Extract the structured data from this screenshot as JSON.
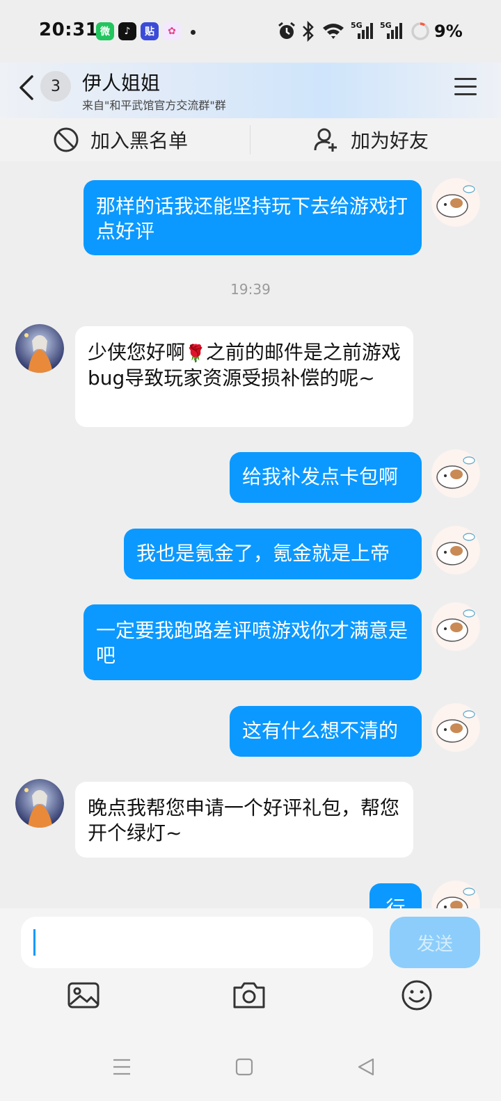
{
  "status_bar": {
    "time": "20:31",
    "apps": [
      "wechat-icon",
      "douyin-icon",
      "tieba-icon",
      "colorful-app-icon"
    ],
    "app_glyphs": [
      "微",
      "♪",
      "贴",
      "✿"
    ],
    "network": [
      "5G",
      "5G"
    ],
    "battery": "9%"
  },
  "header": {
    "unread_count": "3",
    "title": "伊人姐姐",
    "subtitle": "来自\"和平武馆官方交流群\"群"
  },
  "actions": {
    "block_label": "加入黑名单",
    "add_friend_label": "加为好友"
  },
  "messages": [
    {
      "side": "out",
      "text": "那样的话我还能坚持玩下去给游戏打点好评"
    },
    {
      "side": "time",
      "text": "19:39"
    },
    {
      "side": "in",
      "text_before": "少侠您好啊",
      "emoji": "🌹",
      "text_after": "之前的邮件是之前游戏bug导致玩家资源受损补偿的呢~"
    },
    {
      "side": "out",
      "text": "给我补发点卡包啊"
    },
    {
      "side": "out",
      "text": "我也是氪金了，氪金就是上帝"
    },
    {
      "side": "out",
      "text": "一定要我跑路差评喷游戏你才满意是吧"
    },
    {
      "side": "out",
      "text": "这有什么想不清的"
    },
    {
      "side": "in",
      "text": "晚点我帮您申请一个好评礼包，帮您开个绿灯~"
    },
    {
      "side": "out",
      "text": "行"
    }
  ],
  "composer": {
    "input_value": "",
    "send_label": "发送"
  },
  "colors": {
    "accent": "#0b99ff",
    "send_disabled": "#8ccdfb",
    "background": "#eeeeef"
  }
}
